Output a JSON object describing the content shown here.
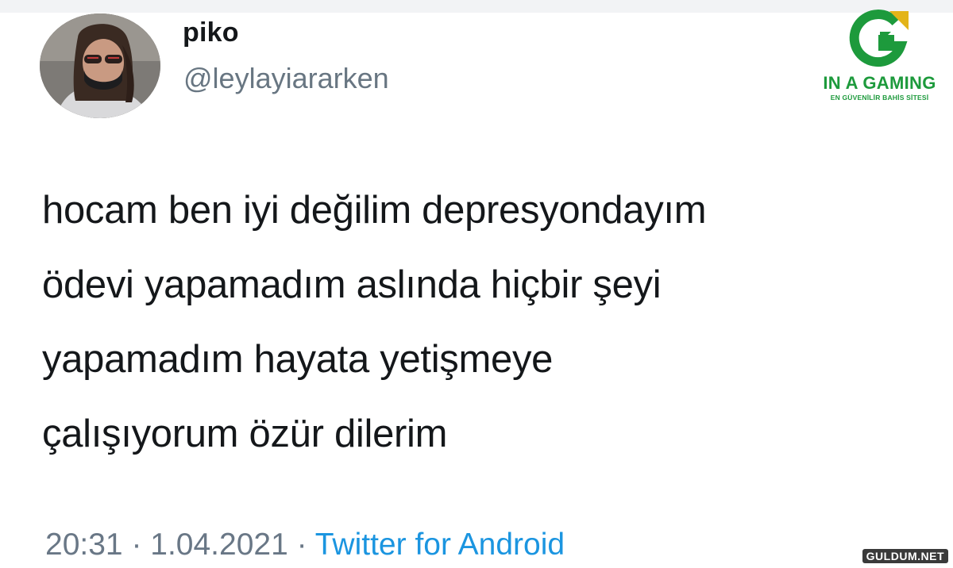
{
  "tweet": {
    "author": {
      "display_name": "piko",
      "handle": "@leylayiararken",
      "avatar_icon": "profile-photo"
    },
    "text_lines": [
      "hocam ben iyi değilim depresyondayım",
      "ödevi yapamadım aslında hiçbir şeyi",
      "yapamadım hayata yetişmeye",
      "çalışıyorum özür dilerim"
    ],
    "time": "20:31",
    "separator": "·",
    "date": "1.04.2021",
    "source": "Twitter for Android"
  },
  "logo": {
    "brand": "IN A GAMING",
    "tagline": "EN GÜVENİLİR BAHİS SİTESİ",
    "colors": {
      "green": "#1d9a3c",
      "gold": "#e3b419"
    }
  },
  "watermark": {
    "text": "GULDUM.NET"
  },
  "colors": {
    "text": "#14171a",
    "secondary": "#697786",
    "link": "#1b95e0"
  }
}
